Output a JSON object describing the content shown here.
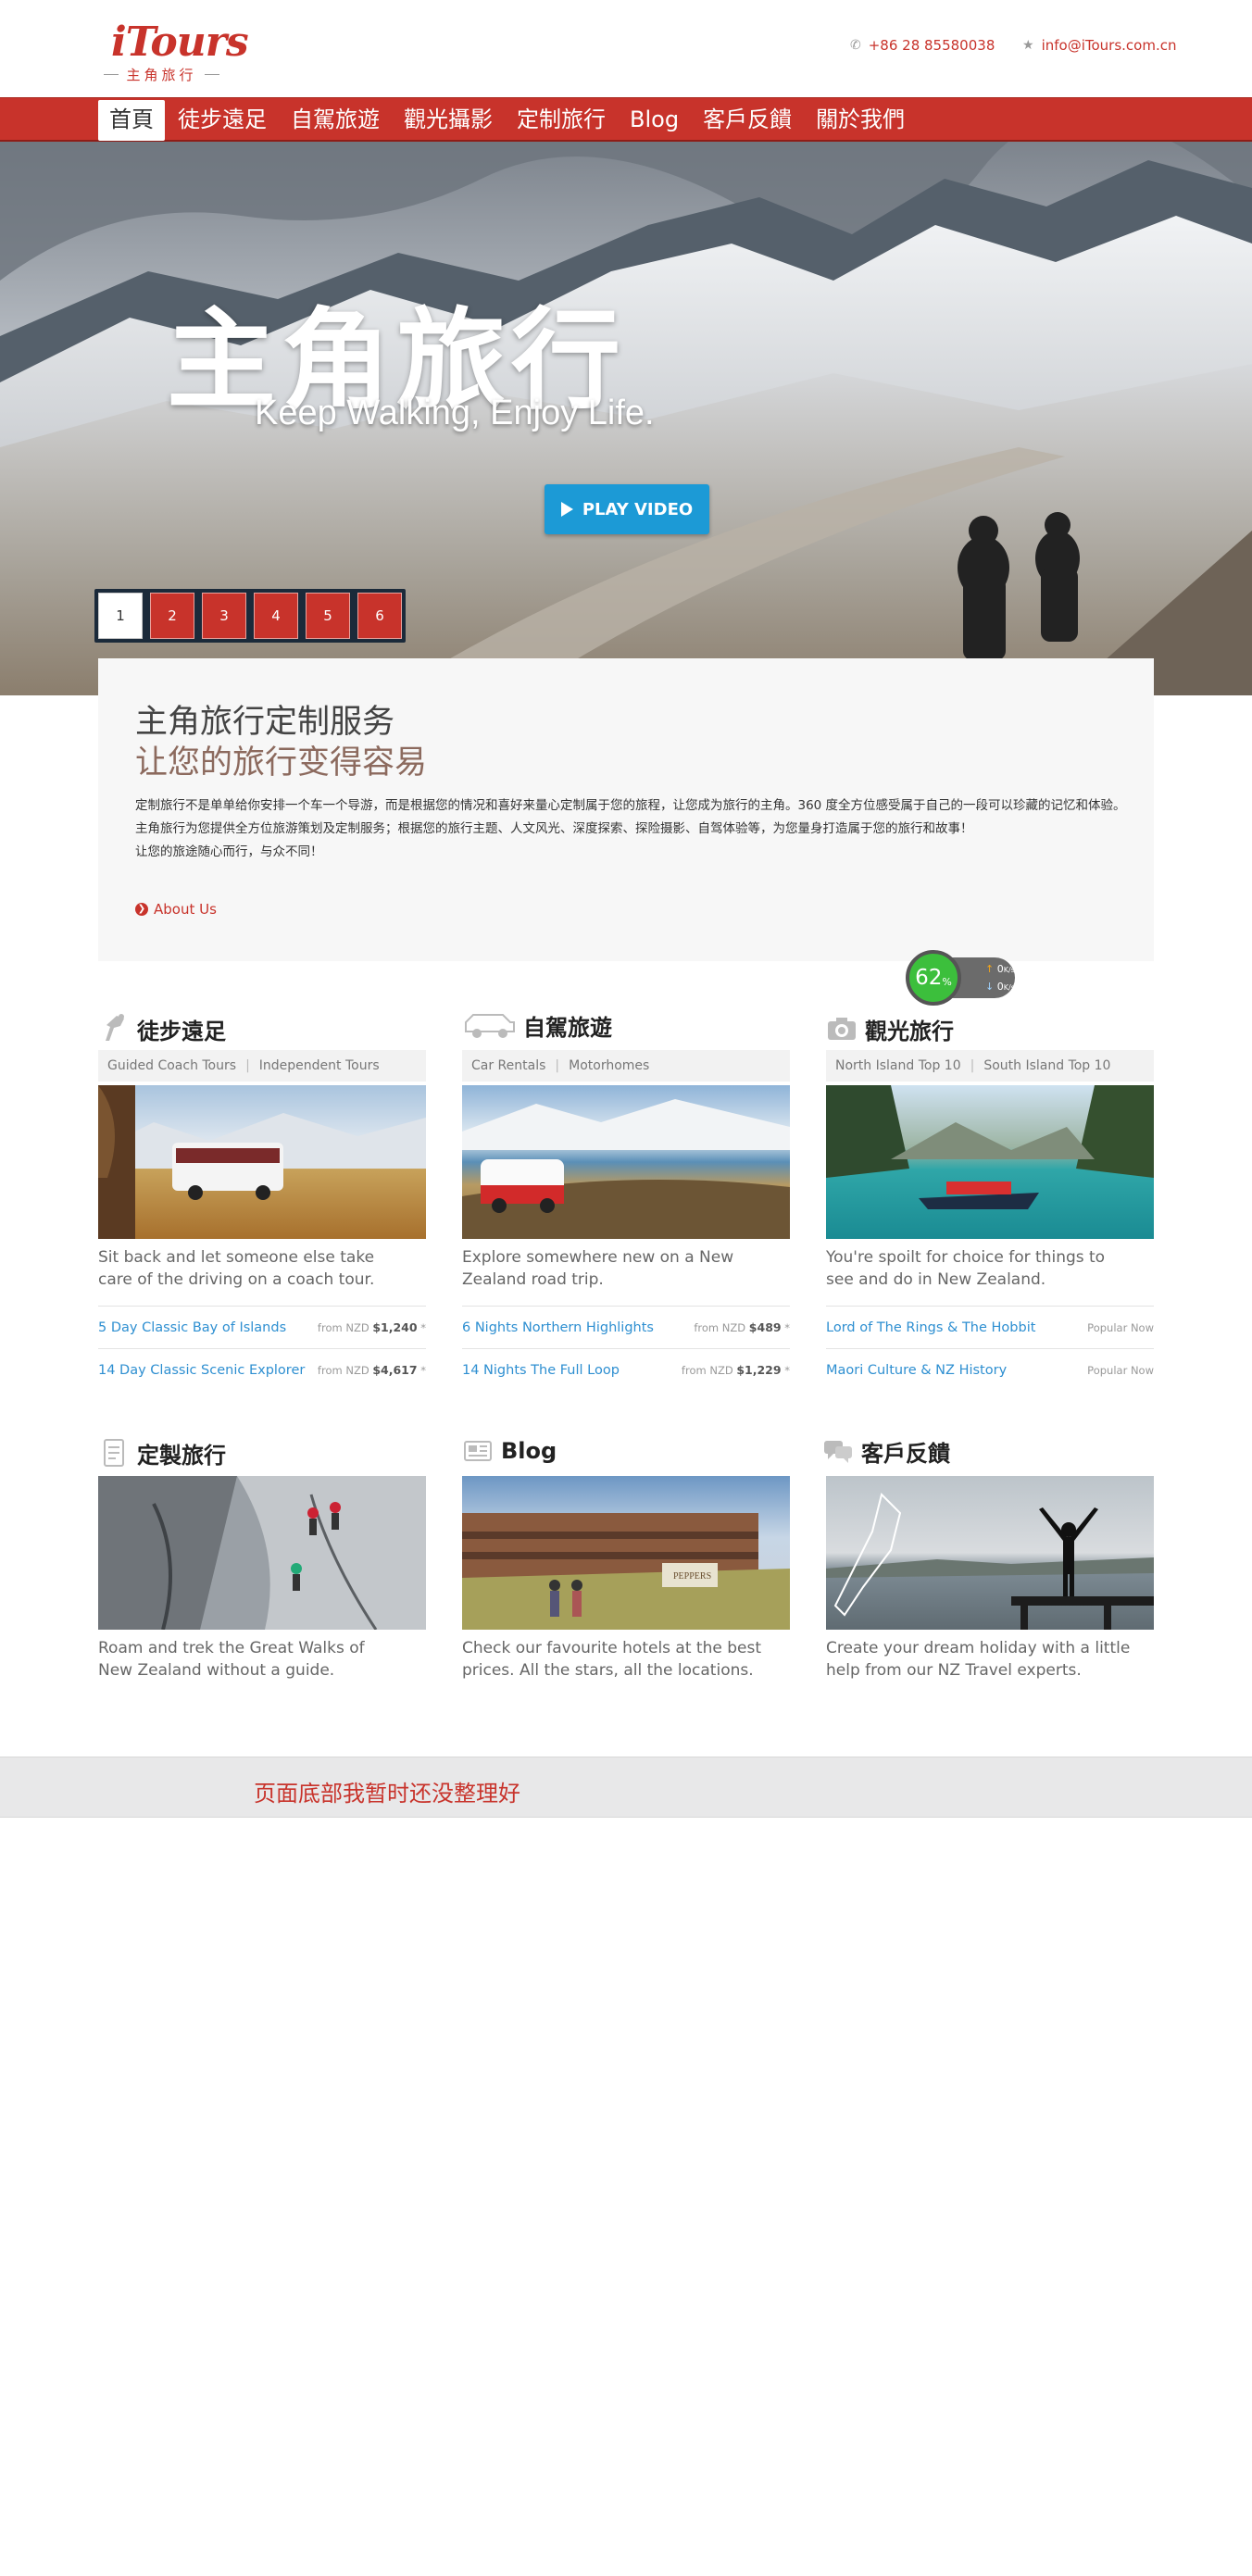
{
  "header": {
    "logo_text": "iTours",
    "logo_sub": "主角旅行",
    "phone": "+86 28 85580038",
    "email": "info@iTours.com.cn"
  },
  "nav": {
    "items": [
      {
        "label": "首頁",
        "active": true
      },
      {
        "label": "徒步遠足"
      },
      {
        "label": "自駕旅遊"
      },
      {
        "label": "觀光攝影"
      },
      {
        "label": "定制旅行"
      },
      {
        "label": "Blog"
      },
      {
        "label": "客戶反饋"
      },
      {
        "label": "關於我們"
      }
    ]
  },
  "hero": {
    "title": "主角旅行",
    "subtitle": "Keep Walking, Enjoy Life.",
    "play_label": "PLAY VIDEO",
    "pages": [
      "1",
      "2",
      "3",
      "4",
      "5",
      "6"
    ],
    "active_page": "1"
  },
  "intro": {
    "heading": "主角旅行定制服务",
    "subheading": "让您的旅行变得容易",
    "line1": "定制旅行不是单单给你安排一个车一个导游，而是根据您的情况和喜好来量心定制属于您的旅程，让您成为旅行的主角。360 度全方位感受属于自己的一段可以珍藏的记忆和体验。",
    "line2": "主角旅行为您提供全方位旅游策划及定制服务；根据您的旅行主题、人文风光、深度探索、探险摄影、自驾体验等，为您量身打造属于您的旅行和故事！",
    "line3": "让您的旅途随心而行，与众不同！",
    "more_label": "About Us"
  },
  "speed_widget": {
    "percent": "62",
    "percent_unit": "%",
    "up": "0",
    "down": "0",
    "unit": "K/s"
  },
  "cards": {
    "hiking": {
      "title": "徒步遠足",
      "tab1": "Guided Coach Tours",
      "tab2": "Independent Tours",
      "desc": "Sit back and let someone else take care of the driving on a coach tour.",
      "links": [
        {
          "label": "5 Day Classic Bay of Islands",
          "from": "from NZD",
          "price": "$1,240",
          "mark": "*"
        },
        {
          "label": "14 Day Classic Scenic Explorer",
          "from": "from NZD",
          "price": "$4,617",
          "mark": "*"
        }
      ]
    },
    "selfdrive": {
      "title": "自駕旅遊",
      "tab1": "Car Rentals",
      "tab2": "Motorhomes",
      "desc": "Explore somewhere new on a New Zealand road trip.",
      "links": [
        {
          "label": "6 Nights Northern Highlights",
          "from": "from NZD",
          "price": "$489",
          "mark": "*"
        },
        {
          "label": "14 Nights The Full Loop",
          "from": "from NZD",
          "price": "$1,229",
          "mark": "*"
        }
      ]
    },
    "sightseeing": {
      "title": "觀光旅行",
      "tab1": "North Island Top 10",
      "tab2": "South Island Top 10",
      "desc": "You're spoilt for choice for things to see and do in New Zealand.",
      "links": [
        {
          "label": "Lord of The Rings & The Hobbit",
          "tag": "Popular Now"
        },
        {
          "label": "Maori Culture & NZ History",
          "tag": "Popular Now"
        }
      ]
    },
    "custom": {
      "title": "定製旅行",
      "desc": "Roam and trek the Great Walks of New Zealand without a guide."
    },
    "blog": {
      "title": "Blog",
      "desc": "Check our favourite hotels at the best prices. All the stars, all the locations.",
      "sign": "PEPPERS"
    },
    "feedback": {
      "title": "客戶反饋",
      "desc": "Create your dream holiday with a little help from our NZ Travel experts."
    }
  },
  "footer": {
    "message": "页面底部我暂时还没整理好"
  },
  "colors": {
    "brand_red": "#c8332b",
    "link_blue": "#2e8fd1",
    "play_blue": "#1c9ad6"
  }
}
